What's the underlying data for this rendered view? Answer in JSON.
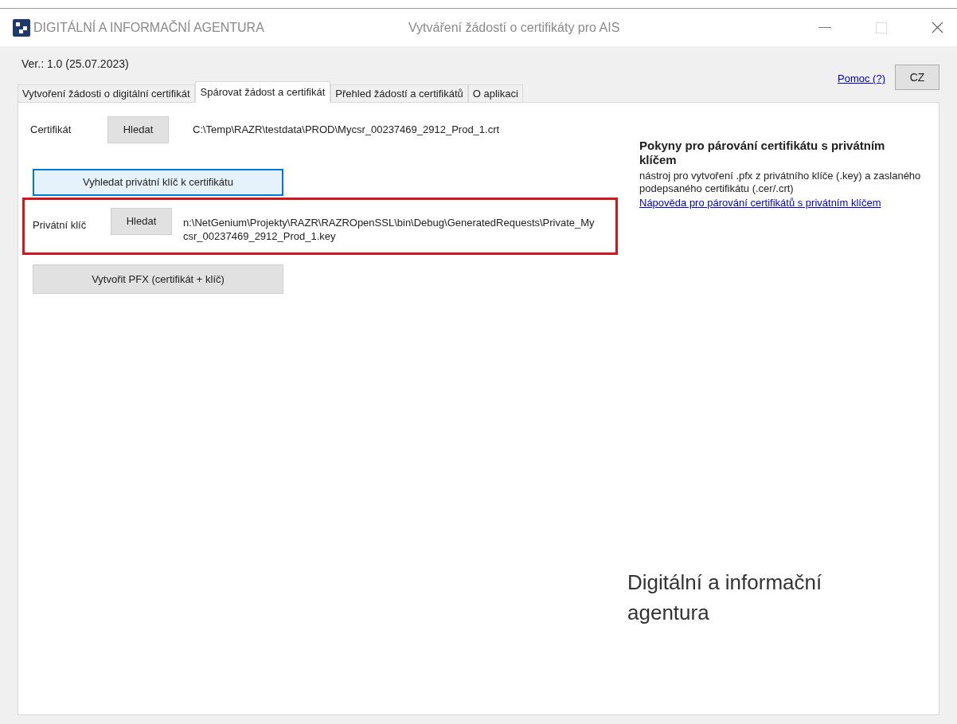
{
  "window": {
    "app_name": "DIGITÁLNÍ A INFORMAČNÍ AGENTURA",
    "title": "Vytváření žádostí o certifikáty pro AIS"
  },
  "version": "Ver.: 1.0 (25.07.2023)",
  "help_link": "Pomoc (?)",
  "language_button": "CZ",
  "tabs": [
    {
      "label": "Vytvoření žádosti o digitální certifikát",
      "selected": false
    },
    {
      "label": "Spárovat žádost a certifikát",
      "selected": true
    },
    {
      "label": "Přehled žádostí a certifikátů",
      "selected": false
    },
    {
      "label": "O aplikaci",
      "selected": false
    }
  ],
  "certificate": {
    "label": "Certifikát",
    "button": "Hledat",
    "path": "C:\\Temp\\RAZR\\testdata\\PROD\\Mycsr_00237469_2912_Prod_1.crt"
  },
  "find_key_button": "Vyhledat privátní klíč k certifikátu",
  "private_key": {
    "label": "Privátní klíč",
    "button": "Hledat",
    "path": "n:\\NetGenium\\Projekty\\RAZR\\RAZROpenSSL\\bin\\Debug\\GeneratedRequests\\Private_Mycsr_00237469_2912_Prod_1.key",
    "highlighted": true
  },
  "create_pfx_button": "Vytvořit PFX (certifikát + klíč)",
  "instructions": {
    "title": "Pokyny pro párování certifikátu s privátním klíčem",
    "text": "nástroj pro vytvoření .pfx z privátního klíče (.key) a zaslaného podepsaného certifikátu (.cer/.crt)",
    "link": "Nápověda pro párování certifikátů s privátním klíčem"
  },
  "brand_text": "Digitální a informační agentura"
}
